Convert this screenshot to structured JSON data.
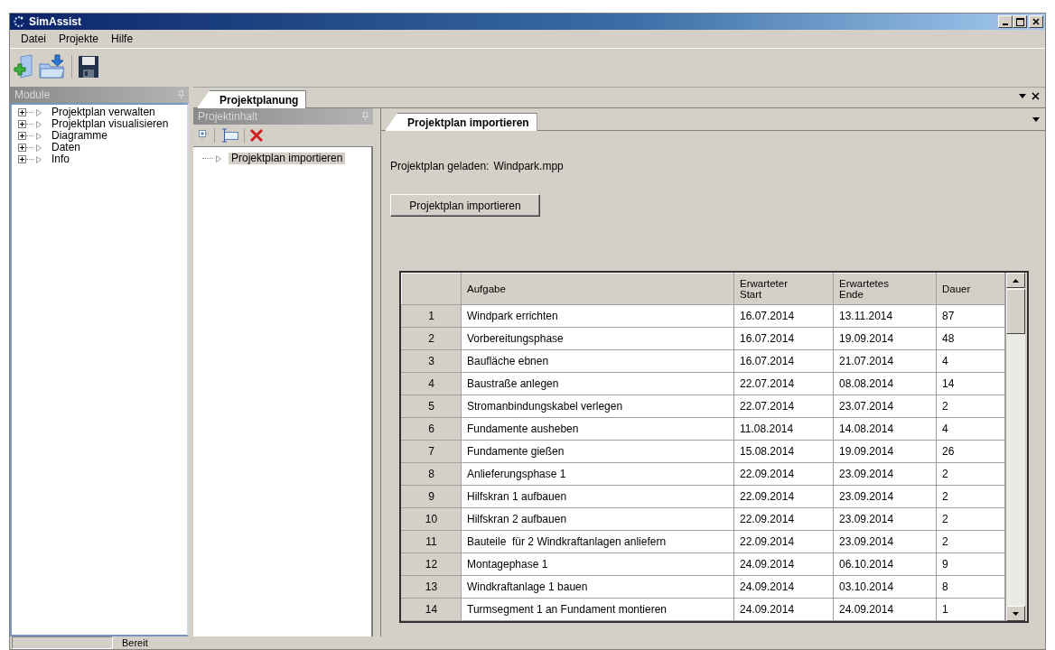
{
  "window": {
    "title": "SimAssist"
  },
  "menu": [
    {
      "label": "Datei"
    },
    {
      "label": "Projekte"
    },
    {
      "label": "Hilfe"
    }
  ],
  "module_panel": {
    "title": "Module",
    "items": [
      {
        "label": "Projektplan verwalten",
        "expanded": false
      },
      {
        "label": "Projektplan visualisieren",
        "expanded": false
      },
      {
        "label": "Diagramme",
        "expanded": false
      },
      {
        "label": "Daten",
        "expanded": false
      },
      {
        "label": "Info",
        "expanded": false
      }
    ]
  },
  "document_tabs": [
    {
      "label": "Projektplanung",
      "selected": true
    }
  ],
  "content_panel": {
    "title": "Projektinhalt",
    "items": [
      {
        "label": "Projektplan importieren",
        "selected": true
      }
    ]
  },
  "inner_tabs": [
    {
      "label": "Projektplan importieren",
      "selected": true
    }
  ],
  "import_view": {
    "status_label": "Projektplan geladen:",
    "file_name": "Windpark.mpp",
    "button": "Projektplan importieren"
  },
  "table": {
    "columns": [
      "Aufgabe",
      "Erwarteter Start",
      "Erwartetes Ende",
      "Dauer"
    ],
    "rows": [
      {
        "number": "1",
        "cells": [
          "Windpark errichten",
          "16.07.2014",
          "13.11.2014",
          "87"
        ]
      },
      {
        "number": "2",
        "cells": [
          "Vorbereitungsphase",
          "16.07.2014",
          "19.09.2014",
          "48"
        ]
      },
      {
        "number": "3",
        "cells": [
          "Baufläche ebnen",
          "16.07.2014",
          "21.07.2014",
          "4"
        ]
      },
      {
        "number": "4",
        "cells": [
          "Baustraße anlegen",
          "22.07.2014",
          "08.08.2014",
          "14"
        ]
      },
      {
        "number": "5",
        "cells": [
          "Stromanbindungskabel verlegen",
          "22.07.2014",
          "23.07.2014",
          "2"
        ]
      },
      {
        "number": "6",
        "cells": [
          "Fundamente ausheben",
          "11.08.2014",
          "14.08.2014",
          "4"
        ]
      },
      {
        "number": "7",
        "cells": [
          "Fundamente gießen",
          "15.08.2014",
          "19.09.2014",
          "26"
        ]
      },
      {
        "number": "8",
        "cells": [
          "Anlieferungsphase 1",
          "22.09.2014",
          "23.09.2014",
          "2"
        ]
      },
      {
        "number": "9",
        "cells": [
          "Hilfskran 1 aufbauen",
          "22.09.2014",
          "23.09.2014",
          "2"
        ]
      },
      {
        "number": "10",
        "cells": [
          "Hilfskran 2 aufbauen",
          "22.09.2014",
          "23.09.2014",
          "2"
        ]
      },
      {
        "number": "11",
        "cells": [
          "Bauteile  für 2 Windkraftanlagen anliefern",
          "22.09.2014",
          "23.09.2014",
          "2"
        ]
      },
      {
        "number": "12",
        "cells": [
          "Montagephase 1",
          "24.09.2014",
          "06.10.2014",
          "9"
        ]
      },
      {
        "number": "13",
        "cells": [
          "Windkraftanlage 1 bauen",
          "24.09.2014",
          "03.10.2014",
          "8"
        ]
      },
      {
        "number": "14",
        "cells": [
          "Turmsegment 1 an Fundament montieren",
          "24.09.2014",
          "24.09.2014",
          "1"
        ]
      }
    ]
  },
  "status_bar": {
    "level": 0,
    "text": "Bereit"
  }
}
